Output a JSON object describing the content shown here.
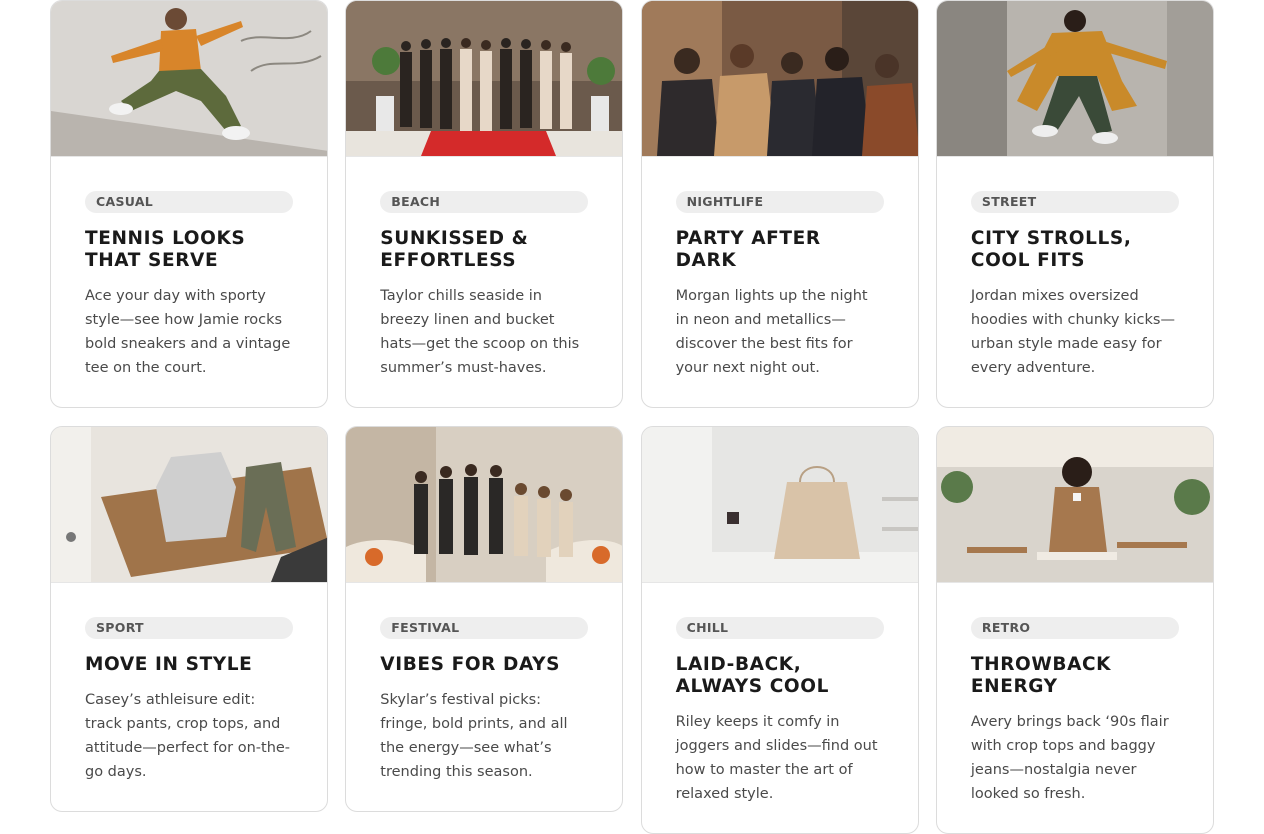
{
  "cards": [
    {
      "tag": "CASUAL",
      "title": "TENNIS LOOKS THAT SERVE",
      "description": "Ace your day with sporty style—see how Jamie rocks bold sneakers and a vintage tee on the court.",
      "image_colors": [
        "#d9d6d2",
        "#b9b4ae",
        "#d8852a",
        "#5d6a3c"
      ]
    },
    {
      "tag": "BEACH",
      "title": "SUNKISSED & EFFORTLESS",
      "description": "Taylor chills seaside in breezy linen and bucket hats—get the scoop on this summer’s must-haves.",
      "image_colors": [
        "#6b5a4c",
        "#3a3330",
        "#d42a2a",
        "#e8e4dd"
      ]
    },
    {
      "tag": "NIGHTLIFE",
      "title": "PARTY AFTER DARK",
      "description": "Morgan lights up the night in neon and metallics—discover the best fits for your next night out.",
      "image_colors": [
        "#a07a5a",
        "#4a3a30",
        "#c79a6a",
        "#2a2a30"
      ]
    },
    {
      "tag": "STREET",
      "title": "CITY STROLLS, COOL FITS",
      "description": "Jordan mixes oversized hoodies with chunky kicks—urban style made easy for every adventure.",
      "image_colors": [
        "#b8b4ae",
        "#8a8680",
        "#c98a2a",
        "#3a4a38"
      ]
    },
    {
      "tag": "SPORT",
      "title": "MOVE IN STYLE",
      "description": "Casey’s athleisure edit: track pants, crop tops, and attitude—perfect for on-the-go days.",
      "image_colors": [
        "#e8e4de",
        "#a0744a",
        "#cfcfcf",
        "#6a6e56"
      ]
    },
    {
      "tag": "FESTIVAL",
      "title": "VIBES FOR DAYS",
      "description": "Skylar’s festival picks: fringe, bold prints, and all the energy—see what’s trending this season.",
      "image_colors": [
        "#d8cfc2",
        "#2a2826",
        "#d86a2a",
        "#efe8dd"
      ]
    },
    {
      "tag": "CHILL",
      "title": "LAID-BACK, ALWAYS COOL",
      "description": "Riley keeps it comfy in joggers and slides—find out how to master the art of relaxed style.",
      "image_colors": [
        "#e6e6e4",
        "#d2d0cc",
        "#d9c3a8",
        "#f2f2f0"
      ]
    },
    {
      "tag": "RETRO",
      "title": "THROWBACK ENERGY",
      "description": "Avery brings back ‘90s flair with crop tops and baggy jeans—nostalgia never looked so fresh.",
      "image_colors": [
        "#d9d4cc",
        "#a6784e",
        "#5a7a4a",
        "#f0ebe3"
      ]
    }
  ]
}
